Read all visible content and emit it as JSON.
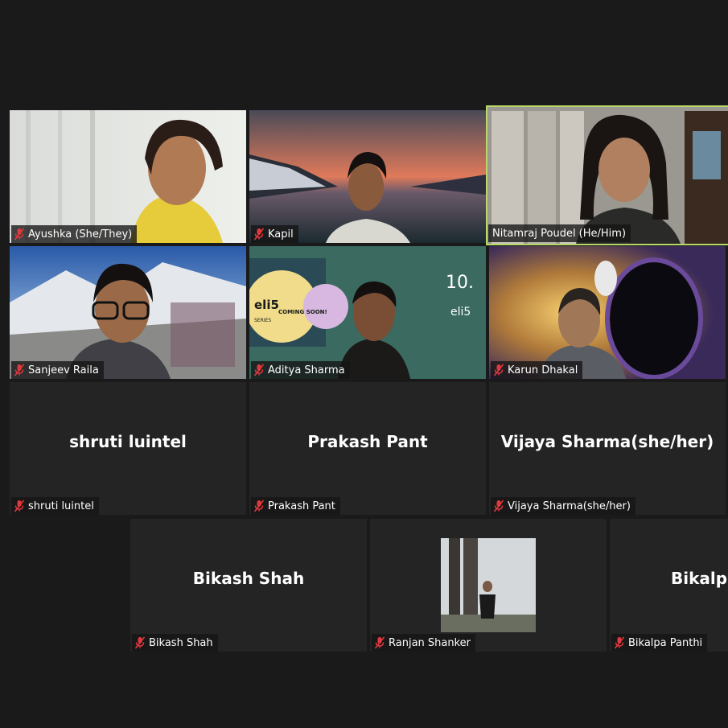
{
  "participants": [
    {
      "name": "Ayushka (She/They)",
      "muted": true,
      "video": "on"
    },
    {
      "name": "Kapil",
      "muted": true,
      "video": "on"
    },
    {
      "name": "Nitamraj Poudel (He/Him)",
      "muted": false,
      "video": "on",
      "active_speaker": true
    },
    {
      "name": "Sanjeev Raila",
      "muted": true,
      "video": "on"
    },
    {
      "name": "Aditya Sharma",
      "muted": true,
      "video": "on",
      "background_text": {
        "number": "10.",
        "brand": "eli5",
        "badge_logo": "eli5",
        "badge_series": "SERIES",
        "badge_coming": "COMING SOON!"
      }
    },
    {
      "name": "Karun Dhakal",
      "muted": true,
      "video": "on"
    },
    {
      "name": "shruti luintel",
      "muted": true,
      "video": "off",
      "display_name": "shruti luintel"
    },
    {
      "name": "Prakash Pant",
      "muted": true,
      "video": "off",
      "display_name": "Prakash Pant"
    },
    {
      "name": "Vijaya Sharma(she/her)",
      "muted": true,
      "video": "off",
      "display_name": "Vijaya Sharma(she/her)"
    },
    {
      "name": "Bikash Shah",
      "muted": true,
      "video": "off",
      "display_name": "Bikash Shah"
    },
    {
      "name": "Ranjan Shanker",
      "muted": true,
      "video": "off",
      "avatar": "profile-photo"
    },
    {
      "name": "Bikalpa Panthi",
      "muted": true,
      "video": "off",
      "display_name": "Bikalpa"
    }
  ],
  "colors": {
    "background": "#1a1a1a",
    "tile": "#242424",
    "active_border": "#b8d86a",
    "muted_icon": "#e0393e"
  },
  "icons": {
    "muted": "mic-muted-icon"
  }
}
